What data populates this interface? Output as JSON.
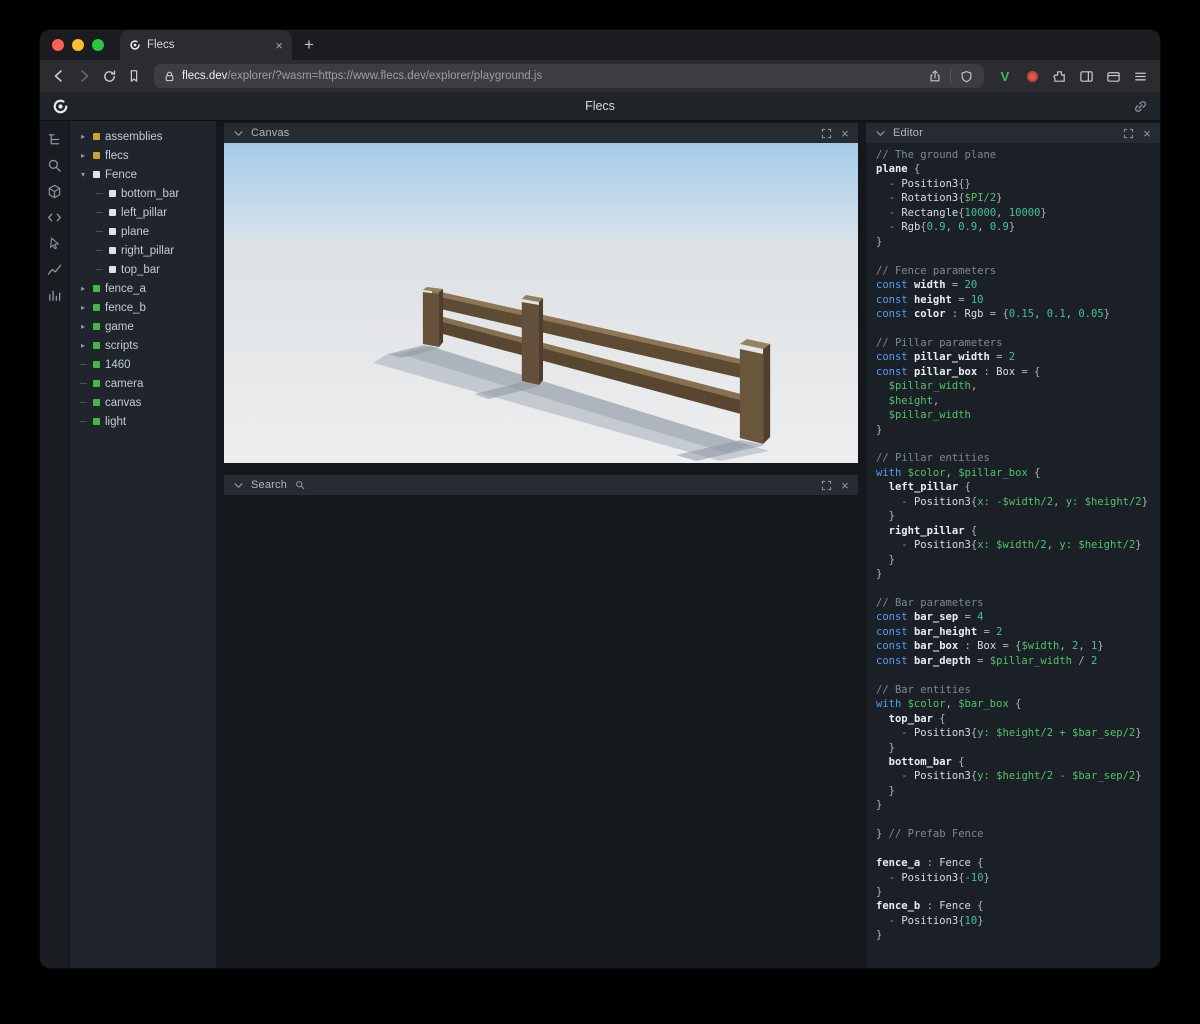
{
  "ui": {
    "close": "×",
    "plus": "+"
  },
  "colors": {
    "accent_green": "#44b549",
    "module_yellow": "#c9a42e",
    "prefab_white": "#dfe3e6",
    "traffic_close": "#ff5f57",
    "traffic_min": "#febc2e",
    "traffic_max": "#28c840",
    "fence_brown": "#5e4b34",
    "sky_blue": "#a5cae9",
    "keyword_blue": "#539bf5",
    "variable_green": "#53c06d"
  },
  "browser": {
    "tab_title": "Flecs",
    "url_domain": "flecs.dev",
    "url_path": "/explorer/?wasm=https://www.flecs.dev/explorer/playground.js"
  },
  "app": {
    "title": "Flecs"
  },
  "sidebar": {
    "icons": [
      "hierarchy-icon",
      "search-icon",
      "cube-icon",
      "code-icon",
      "select-icon",
      "chart-icon",
      "stats-icon"
    ]
  },
  "tree": {
    "items": [
      {
        "label": "assemblies",
        "sq": "#c9a42e",
        "depth": 0,
        "arrow": "right"
      },
      {
        "label": "flecs",
        "sq": "#c9a42e",
        "depth": 0,
        "arrow": "right"
      },
      {
        "label": "Fence",
        "sq": "#dfe3e6",
        "depth": 0,
        "arrow": "down"
      },
      {
        "label": "bottom_bar",
        "sq": "#dfe3e6",
        "depth": 1,
        "arrow": "none"
      },
      {
        "label": "left_pillar",
        "sq": "#dfe3e6",
        "depth": 1,
        "arrow": "none"
      },
      {
        "label": "plane",
        "sq": "#dfe3e6",
        "depth": 1,
        "arrow": "none"
      },
      {
        "label": "right_pillar",
        "sq": "#dfe3e6",
        "depth": 1,
        "arrow": "none"
      },
      {
        "label": "top_bar",
        "sq": "#dfe3e6",
        "depth": 1,
        "arrow": "none"
      },
      {
        "label": "fence_a",
        "sq": "#44b549",
        "depth": 0,
        "arrow": "right"
      },
      {
        "label": "fence_b",
        "sq": "#44b549",
        "depth": 0,
        "arrow": "right"
      },
      {
        "label": "game",
        "sq": "#44b549",
        "depth": 0,
        "arrow": "right"
      },
      {
        "label": "scripts",
        "sq": "#44b549",
        "depth": 0,
        "arrow": "right"
      },
      {
        "label": "1460",
        "sq": "#44b549",
        "depth": 0,
        "arrow": "none"
      },
      {
        "label": "camera",
        "sq": "#44b549",
        "depth": 0,
        "arrow": "none"
      },
      {
        "label": "canvas",
        "sq": "#44b549",
        "depth": 0,
        "arrow": "none"
      },
      {
        "label": "light",
        "sq": "#44b549",
        "depth": 0,
        "arrow": "none"
      }
    ]
  },
  "panels": {
    "canvas": {
      "title": "Canvas"
    },
    "search": {
      "title": "Search"
    },
    "editor": {
      "title": "Editor"
    }
  },
  "editor": {
    "lines": [
      [
        [
          "c",
          "// The ground plane"
        ]
      ],
      [
        [
          "i",
          "plane"
        ],
        [
          "p",
          " {"
        ]
      ],
      [
        [
          "p",
          "  "
        ],
        [
          "d",
          "- "
        ],
        [
          "t",
          "Position3"
        ],
        [
          "p",
          "{}"
        ]
      ],
      [
        [
          "p",
          "  "
        ],
        [
          "d",
          "- "
        ],
        [
          "t",
          "Rotation3"
        ],
        [
          "p",
          "{"
        ],
        [
          "v",
          "$PI/2"
        ],
        [
          "p",
          "}"
        ]
      ],
      [
        [
          "p",
          "  "
        ],
        [
          "d",
          "- "
        ],
        [
          "t",
          "Rectangle"
        ],
        [
          "p",
          "{"
        ],
        [
          "n",
          "10000"
        ],
        [
          "p",
          ", "
        ],
        [
          "n",
          "10000"
        ],
        [
          "p",
          "}"
        ]
      ],
      [
        [
          "p",
          "  "
        ],
        [
          "d",
          "- "
        ],
        [
          "t",
          "Rgb"
        ],
        [
          "p",
          "{"
        ],
        [
          "n",
          "0.9"
        ],
        [
          "p",
          ", "
        ],
        [
          "n",
          "0.9"
        ],
        [
          "p",
          ", "
        ],
        [
          "n",
          "0.9"
        ],
        [
          "p",
          "}"
        ]
      ],
      [
        [
          "p",
          "}"
        ]
      ],
      [],
      [
        [
          "c",
          "// Fence parameters"
        ]
      ],
      [
        [
          "k",
          "const "
        ],
        [
          "i",
          "width"
        ],
        [
          "p",
          " = "
        ],
        [
          "n",
          "20"
        ]
      ],
      [
        [
          "k",
          "const "
        ],
        [
          "i",
          "height"
        ],
        [
          "p",
          " = "
        ],
        [
          "n",
          "10"
        ]
      ],
      [
        [
          "k",
          "const "
        ],
        [
          "i",
          "color"
        ],
        [
          "p",
          " : "
        ],
        [
          "t",
          "Rgb"
        ],
        [
          "p",
          " = {"
        ],
        [
          "n",
          "0.15"
        ],
        [
          "p",
          ", "
        ],
        [
          "n",
          "0.1"
        ],
        [
          "p",
          ", "
        ],
        [
          "n",
          "0.05"
        ],
        [
          "p",
          "}"
        ]
      ],
      [],
      [
        [
          "c",
          "// Pillar parameters"
        ]
      ],
      [
        [
          "k",
          "const "
        ],
        [
          "i",
          "pillar_width"
        ],
        [
          "p",
          " = "
        ],
        [
          "n",
          "2"
        ]
      ],
      [
        [
          "k",
          "const "
        ],
        [
          "i",
          "pillar_box"
        ],
        [
          "p",
          " : "
        ],
        [
          "t",
          "Box"
        ],
        [
          "p",
          " = {"
        ]
      ],
      [
        [
          "p",
          "  "
        ],
        [
          "v",
          "$pillar_width"
        ],
        [
          "p",
          ","
        ]
      ],
      [
        [
          "p",
          "  "
        ],
        [
          "v",
          "$height"
        ],
        [
          "p",
          ","
        ]
      ],
      [
        [
          "p",
          "  "
        ],
        [
          "v",
          "$pillar_width"
        ]
      ],
      [
        [
          "p",
          "}"
        ]
      ],
      [],
      [
        [
          "c",
          "// Pillar entities"
        ]
      ],
      [
        [
          "k",
          "with "
        ],
        [
          "v",
          "$color"
        ],
        [
          "p",
          ", "
        ],
        [
          "v",
          "$pillar_box"
        ],
        [
          "p",
          " {"
        ]
      ],
      [
        [
          "p",
          "  "
        ],
        [
          "i",
          "left_pillar"
        ],
        [
          "p",
          " {"
        ]
      ],
      [
        [
          "p",
          "    "
        ],
        [
          "d",
          "- "
        ],
        [
          "t",
          "Position3"
        ],
        [
          "p",
          "{"
        ],
        [
          "v",
          "x:"
        ],
        [
          "p",
          " "
        ],
        [
          "v",
          "-$width/2"
        ],
        [
          "p",
          ", "
        ],
        [
          "v",
          "y:"
        ],
        [
          "p",
          " "
        ],
        [
          "v",
          "$height/2"
        ],
        [
          "p",
          "}"
        ]
      ],
      [
        [
          "p",
          "  }"
        ]
      ],
      [
        [
          "p",
          "  "
        ],
        [
          "i",
          "right_pillar"
        ],
        [
          "p",
          " {"
        ]
      ],
      [
        [
          "p",
          "    "
        ],
        [
          "d",
          "- "
        ],
        [
          "t",
          "Position3"
        ],
        [
          "p",
          "{"
        ],
        [
          "v",
          "x:"
        ],
        [
          "p",
          " "
        ],
        [
          "v",
          "$width/2"
        ],
        [
          "p",
          ", "
        ],
        [
          "v",
          "y:"
        ],
        [
          "p",
          " "
        ],
        [
          "v",
          "$height/2"
        ],
        [
          "p",
          "}"
        ]
      ],
      [
        [
          "p",
          "  }"
        ]
      ],
      [
        [
          "p",
          "}"
        ]
      ],
      [],
      [
        [
          "c",
          "// Bar parameters"
        ]
      ],
      [
        [
          "k",
          "const "
        ],
        [
          "i",
          "bar_sep"
        ],
        [
          "p",
          " = "
        ],
        [
          "n",
          "4"
        ]
      ],
      [
        [
          "k",
          "const "
        ],
        [
          "i",
          "bar_height"
        ],
        [
          "p",
          " = "
        ],
        [
          "n",
          "2"
        ]
      ],
      [
        [
          "k",
          "const "
        ],
        [
          "i",
          "bar_box"
        ],
        [
          "p",
          " : "
        ],
        [
          "t",
          "Box"
        ],
        [
          "p",
          " = {"
        ],
        [
          "v",
          "$width"
        ],
        [
          "p",
          ", "
        ],
        [
          "n",
          "2"
        ],
        [
          "p",
          ", "
        ],
        [
          "n",
          "1"
        ],
        [
          "p",
          "}"
        ]
      ],
      [
        [
          "k",
          "const "
        ],
        [
          "i",
          "bar_depth"
        ],
        [
          "p",
          " = "
        ],
        [
          "v",
          "$pillar_width"
        ],
        [
          "p",
          " / "
        ],
        [
          "n",
          "2"
        ]
      ],
      [],
      [
        [
          "c",
          "// Bar entities"
        ]
      ],
      [
        [
          "k",
          "with "
        ],
        [
          "v",
          "$color"
        ],
        [
          "p",
          ", "
        ],
        [
          "v",
          "$bar_box"
        ],
        [
          "p",
          " {"
        ]
      ],
      [
        [
          "p",
          "  "
        ],
        [
          "i",
          "top_bar"
        ],
        [
          "p",
          " {"
        ]
      ],
      [
        [
          "p",
          "    "
        ],
        [
          "d",
          "- "
        ],
        [
          "t",
          "Position3"
        ],
        [
          "p",
          "{"
        ],
        [
          "v",
          "y:"
        ],
        [
          "p",
          " "
        ],
        [
          "v",
          "$height/2 + $bar_sep/2"
        ],
        [
          "p",
          "}"
        ]
      ],
      [
        [
          "p",
          "  }"
        ]
      ],
      [
        [
          "p",
          "  "
        ],
        [
          "i",
          "bottom_bar"
        ],
        [
          "p",
          " {"
        ]
      ],
      [
        [
          "p",
          "    "
        ],
        [
          "d",
          "- "
        ],
        [
          "t",
          "Position3"
        ],
        [
          "p",
          "{"
        ],
        [
          "v",
          "y:"
        ],
        [
          "p",
          " "
        ],
        [
          "v",
          "$height/2 - $bar_sep/2"
        ],
        [
          "p",
          "}"
        ]
      ],
      [
        [
          "p",
          "  }"
        ]
      ],
      [
        [
          "p",
          "}"
        ]
      ],
      [],
      [
        [
          "p",
          "} "
        ],
        [
          "c",
          "// Prefab Fence"
        ]
      ],
      [],
      [
        [
          "i",
          "fence_a"
        ],
        [
          "p",
          " : "
        ],
        [
          "t",
          "Fence"
        ],
        [
          "p",
          " {"
        ]
      ],
      [
        [
          "p",
          "  "
        ],
        [
          "d",
          "- "
        ],
        [
          "t",
          "Position3"
        ],
        [
          "p",
          "{"
        ],
        [
          "n",
          "-10"
        ],
        [
          "p",
          "}"
        ]
      ],
      [
        [
          "p",
          "}"
        ]
      ],
      [
        [
          "i",
          "fence_b"
        ],
        [
          "p",
          " : "
        ],
        [
          "t",
          "Fence"
        ],
        [
          "p",
          " {"
        ]
      ],
      [
        [
          "p",
          "  "
        ],
        [
          "d",
          "- "
        ],
        [
          "t",
          "Position3"
        ],
        [
          "p",
          "{"
        ],
        [
          "n",
          "10"
        ],
        [
          "p",
          "}"
        ]
      ],
      [
        [
          "p",
          "}"
        ]
      ]
    ]
  }
}
